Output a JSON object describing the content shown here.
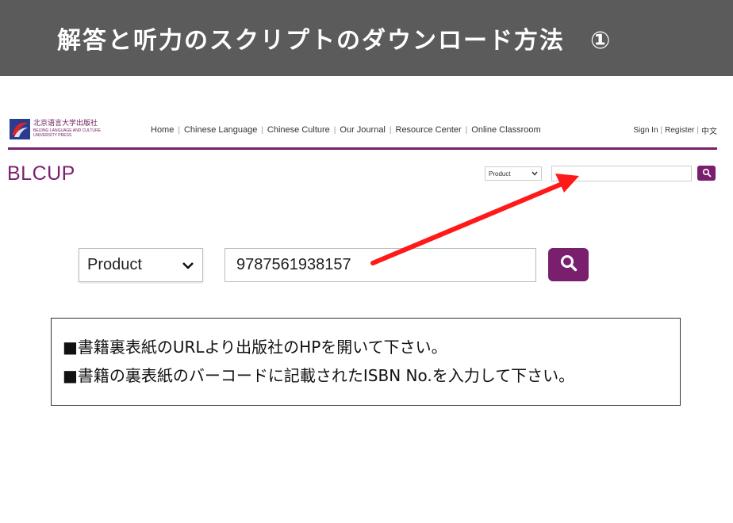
{
  "banner": {
    "title": "解答と听力のスクリプトのダウンロード方法　①"
  },
  "site": {
    "logo_cn": "北京语言大学出版社",
    "logo_en_1": "BEIJING LANGUAGE AND CULTURE",
    "logo_en_2": "UNIVERSITY PRESS",
    "nav": [
      "Home",
      "Chinese Language",
      "Chinese Culture",
      "Our Journal",
      "Resource Center",
      "Online Classroom"
    ],
    "account": {
      "sign_in": "Sign In",
      "register": "Register",
      "lang": "中文"
    },
    "brand": "BLCUP",
    "search": {
      "type_selected": "Product",
      "query": ""
    },
    "accent_color": "#7a1f6e"
  },
  "zoom_search": {
    "type_selected": "Product",
    "query": "9787561938157"
  },
  "instructions": {
    "line1": "■書籍裏表紙のURLより出版社のHPを開いて下さい。",
    "line2": "■書籍の裏表紙のバーコードに記載されたISBN No.を入力して下さい。"
  },
  "annotation": {
    "arrow_color": "#ff1a1a"
  },
  "icons": {
    "search": "search-icon",
    "dropdown": "chevron-down-icon",
    "arrow": "red-arrow-icon"
  }
}
